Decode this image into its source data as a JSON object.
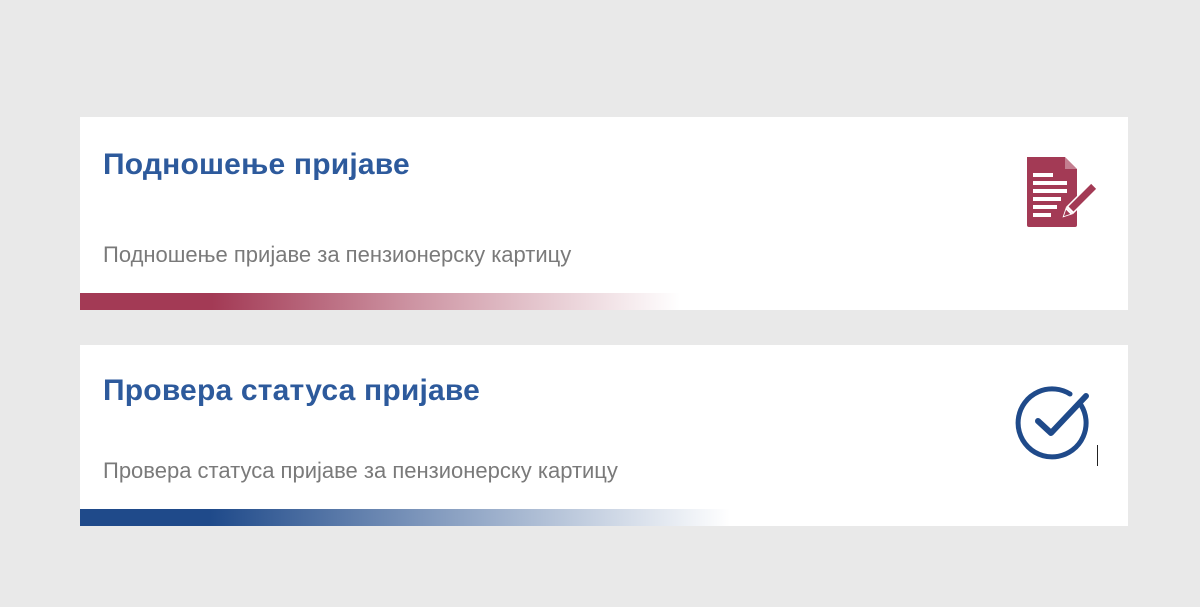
{
  "cards": [
    {
      "title": "Подношење пријаве",
      "description": "Подношење пријаве за пензионерску картицу",
      "icon": "document-signature-icon",
      "accent_color": "#a33a55"
    },
    {
      "title": "Провера статуса пријаве",
      "description": "Провера статуса пријаве за пензионерску картицу",
      "icon": "check-circle-icon",
      "accent_color": "#1f4a8a"
    }
  ],
  "colors": {
    "page_background": "#e9e9e9",
    "card_background": "#ffffff",
    "title": "#2d5a9c",
    "description": "#7a7a7a"
  }
}
